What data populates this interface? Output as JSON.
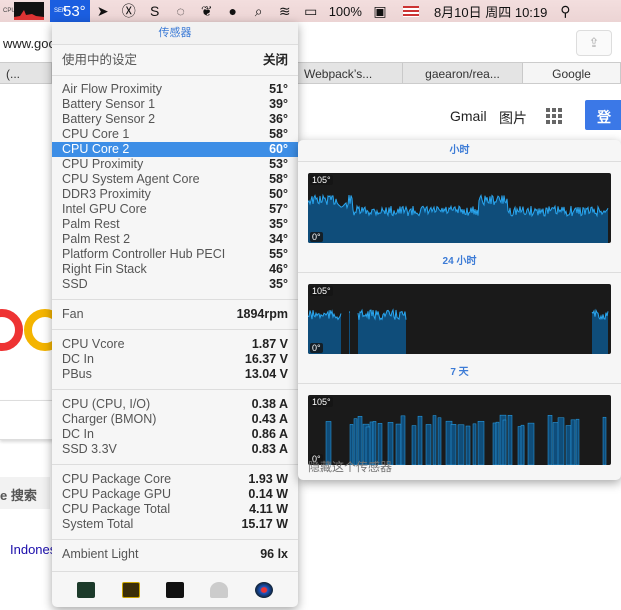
{
  "menubar": {
    "cpu_label": "CPU",
    "sensor_label": "SEN",
    "sensor_temp": "53°",
    "battery": "100%",
    "datetime": "8月10日 周四  10:19",
    "icons": [
      "arrow-icon",
      "wrench-icon",
      "s-icon",
      "chat-icon",
      "evernote-icon",
      "wechat-icon",
      "search-doc-icon",
      "wifi-icon",
      "airplay-icon",
      "battery-icon",
      "flag-us-icon",
      "spotlight-icon"
    ]
  },
  "browser": {
    "address": "www.goo",
    "tabs": [
      "(...",
      "",
      "Webpack’s...",
      "gaearon/rea...",
      "Google"
    ],
    "gmail": "Gmail",
    "images": "图片",
    "login": "登录",
    "search_button": "e 搜索",
    "link": "Indones"
  },
  "menu": {
    "title": "传感器",
    "setting_label": "使用中的设定",
    "setting_value": "关闭",
    "temps": [
      [
        "Air Flow Proximity",
        "51°"
      ],
      [
        "Battery Sensor 1",
        "39°"
      ],
      [
        "Battery Sensor 2",
        "36°"
      ],
      [
        "CPU Core 1",
        "58°"
      ],
      [
        "CPU Core 2",
        "60°"
      ],
      [
        "CPU Proximity",
        "53°"
      ],
      [
        "CPU System Agent Core",
        "58°"
      ],
      [
        "DDR3 Proximity",
        "50°"
      ],
      [
        "Intel GPU Core",
        "57°"
      ],
      [
        "Palm Rest",
        "35°"
      ],
      [
        "Palm Rest 2",
        "34°"
      ],
      [
        "Platform Controller Hub PECI",
        "55°"
      ],
      [
        "Right Fin Stack",
        "46°"
      ],
      [
        "SSD",
        "35°"
      ]
    ],
    "selected": "CPU Core 2",
    "fans": [
      [
        "Fan",
        "1894rpm"
      ]
    ],
    "voltages": [
      [
        "CPU Vcore",
        "1.87 V"
      ],
      [
        "DC In",
        "16.37 V"
      ],
      [
        "PBus",
        "13.04 V"
      ]
    ],
    "currents": [
      [
        "CPU (CPU, I/O)",
        "0.38 A"
      ],
      [
        "Charger (BMON)",
        "0.43 A"
      ],
      [
        "DC In",
        "0.86 A"
      ],
      [
        "SSD 3.3V",
        "0.83 A"
      ]
    ],
    "power": [
      [
        "CPU Package Core",
        "1.93 W"
      ],
      [
        "CPU Package GPU",
        "0.14 W"
      ],
      [
        "CPU Package Total",
        "4.11 W"
      ],
      [
        "System Total",
        "15.17 W"
      ]
    ],
    "light": [
      [
        "Ambient Light",
        "96 lx"
      ]
    ],
    "footer_icons": [
      "activity-monitor-icon",
      "console-icon",
      "terminal-icon",
      "disk-utility-icon",
      "istat-icon"
    ]
  },
  "graphs": {
    "sections": [
      {
        "title": "小时",
        "max": "105°",
        "min": "0°"
      },
      {
        "title": "24 小时",
        "max": "105°",
        "min": "0°"
      },
      {
        "title": "7 天",
        "max": "105°",
        "min": "0°"
      }
    ],
    "hide_label": "隐藏这个传感器",
    "colors": {
      "line": "#2aa6ef",
      "fill": "#0f4d7a"
    }
  }
}
